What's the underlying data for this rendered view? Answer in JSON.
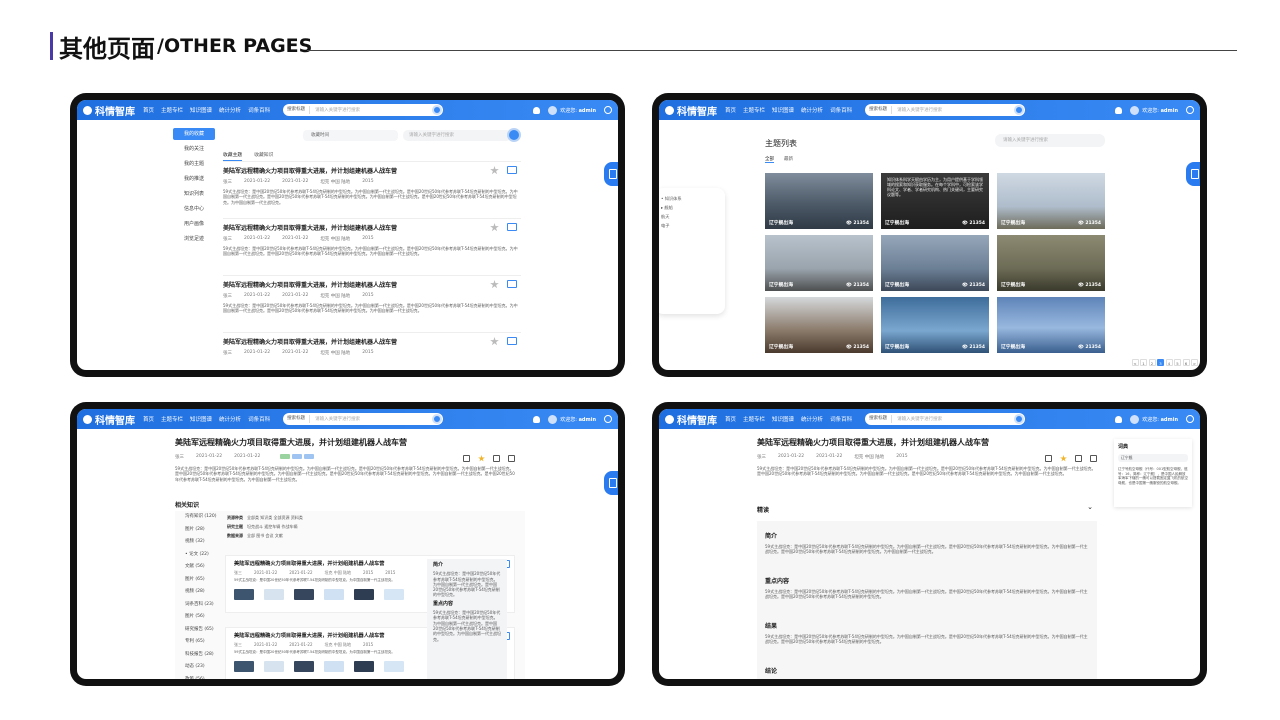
{
  "header": {
    "title_cn": "其他页面",
    "title_en": "/OTHER PAGES"
  },
  "colors": {
    "accent": "#3a8af5",
    "nav_start": "#1f6fe0",
    "nav_end": "#3a8af5",
    "star_active": "#f0b52b",
    "star_inactive": "#bbbbbb",
    "device_frame": "#111111"
  },
  "app": {
    "logo": "科情智库",
    "nav": [
      "首页",
      "主题专栏",
      "知识图谱",
      "统计分析",
      "词条百科"
    ],
    "search_select": "搜索标题",
    "search_placeholder": "请输入关键字进行搜索",
    "welcome": "欢迎您:",
    "user": "admin"
  },
  "screen1": {
    "sidebar": [
      "我的收藏",
      "我的关注",
      "我的主题",
      "我的推送",
      "知识列表",
      "信息中心",
      "用户画像",
      "浏览足迹"
    ],
    "field_label": "收藏时间",
    "search_placeholder": "请输入关键字进行搜索",
    "tabs": [
      "收藏主题",
      "收藏知识"
    ],
    "articles": [
      {
        "title": "美陆军远程精确火力项目取得重大进展，并计划组建机器人战车营",
        "author": "张三",
        "date1": "2021-01-22",
        "date2": "2021-01-22",
        "tags": "坦克   中国   陆地",
        "views": "2015",
        "body": "59式主战坦克：是中国20世纪50年代参考苏联T-54坦克研制的中型坦克。为中国自制第一代主战坦克。是中国20世纪50年代参考苏联T-54坦克研制的中型坦克。为中国自制第一代主战坦克。是中国20世纪50年代参考苏联T-54坦克研制的中型坦克。为中国自制第一代主战坦克。是中国20世纪50年代参考苏联T-54坦克研制的中型坦克。为中国自制第一代主战坦克。"
      },
      {
        "title": "美陆军远程精确火力项目取得重大进展，并计划组建机器人战车营",
        "author": "张三",
        "date1": "2021-01-22",
        "date2": "2021-01-22",
        "tags": "坦克   中国   陆地",
        "views": "2015",
        "body": "59式主战坦克：是中国20世纪50年代参考苏联T-54坦克研制的中型坦克。为中国自制第一代主战坦克。是中国20世纪50年代参考苏联T-54坦克研制的中型坦克。为中国自制第一代主战坦克。是中国20世纪50年代参考苏联T-54坦克研制的中型坦克。为中国自制第一代主战坦克。"
      },
      {
        "title": "美陆军远程精确火力项目取得重大进展，并计划组建机器人战车营",
        "author": "张三",
        "date1": "2021-01-22",
        "date2": "2021-01-22",
        "tags": "坦克   中国   陆地",
        "views": "2015",
        "body": "59式主战坦克：是中国20世纪50年代参考苏联T-54坦克研制的中型坦克。为中国自制第一代主战坦克。是中国20世纪50年代参考苏联T-54坦克研制的中型坦克。为中国自制第一代主战坦克。是中国20世纪50年代参考苏联T-54坦克研制的中型坦克。为中国自制第一代主战坦克。"
      },
      {
        "title": "美陆军远程精确火力项目取得重大进展，并计划组建机器人战车营",
        "author": "张三",
        "date1": "2021-01-22",
        "date2": "2021-01-22",
        "tags": "坦克   中国   陆地",
        "views": "2015",
        "body": ""
      }
    ]
  },
  "screen2": {
    "title": "主题列表",
    "tabs": [
      "全部",
      "最新"
    ],
    "search_placeholder": "请输入关键字进行搜索",
    "tree": [
      "• 知识体系",
      "  ▸ 舰船",
      "    航天",
      "    电子"
    ],
    "tiles": [
      {
        "label": "辽宁舰出海",
        "count": "👁 21354",
        "overlay": ""
      },
      {
        "label": "辽宁舰出海",
        "count": "👁 21354",
        "overlay": "知识体系科学天赋由学历为主，为用户提供基于学科领域的搜索和知识获取服务。在每个学科中，可检索该学科论文、学者、学者研究机构、热门关键词，主要研究议题等。"
      },
      {
        "label": "辽宁舰出海",
        "count": "👁 21354",
        "overlay": ""
      },
      {
        "label": "辽宁舰出海",
        "count": "👁 21354",
        "overlay": ""
      },
      {
        "label": "辽宁舰出海",
        "count": "👁 21354",
        "overlay": ""
      },
      {
        "label": "辽宁舰出海",
        "count": "👁 21354",
        "overlay": ""
      },
      {
        "label": "辽宁舰出海",
        "count": "👁 21354",
        "overlay": ""
      },
      {
        "label": "辽宁舰出海",
        "count": "👁 21354",
        "overlay": ""
      },
      {
        "label": "辽宁舰出海",
        "count": "👁 21354",
        "overlay": ""
      }
    ],
    "pagination": [
      "<",
      "1",
      "2",
      "3",
      "4",
      "5",
      "6",
      ">"
    ]
  },
  "screen3": {
    "title": "美陆军远程精确火力项目取得重大进展，并计划组建机器人战车营",
    "author": "张三",
    "date1": "2021-01-22",
    "date2": "2021-01-22",
    "body": "59式主战坦克：是中国20世纪50年代参考苏联T-54坦克研制的中型坦克。为中国自制第一代主战坦克。是中国20世纪50年代参考苏联T-54坦克研制的中型坦克。为中国自制第一代主战坦克。是中国20世纪50年代参考苏联T-54坦克研制的中型坦克。为中国自制第一代主战坦克。是中国20世纪50年代参考苏联T-54坦克研制的中型坦克。为中国自制第一代主战坦克。是中国20世纪50年代参考苏联T-54坦克研制的中型坦克。为中国自制第一代主战坦克。",
    "related_label": "相关知识",
    "related_side": [
      "沟有知识 (120)",
      "图片 (28)",
      "视频 (32)",
      "• 论文 (22)",
      "文献 (56)",
      "图片 (65)",
      "视频 (28)",
      "词条百科 (23)",
      "图片 (56)",
      "研究报告 (65)",
      "专利 (65)",
      "科技报告 (28)",
      "动态 (23)",
      "政策 (56)"
    ],
    "filter": [
      [
        "资源种类",
        "全部类  知识类  全部资源  资料类"
      ],
      [
        "研究主题",
        "坦克战斗  遥控车辆  作战车辆"
      ],
      [
        "数据来源",
        "全部  图书  会议  文献"
      ]
    ],
    "cards": [
      {
        "title": "美陆军远程精确火力项目取得重大进展，并计划组建机器人战车营",
        "author": "张三",
        "date1": "2021-01-22",
        "date2": "2021-01-22",
        "tags": "坦克  中国  陆地",
        "views": "2015",
        "views2": "2015",
        "body": "59式主战坦克：是中国20世纪50年代参考苏联T-54坦克研制的中型坦克。为中国自制第一代主战坦克。"
      },
      {
        "title": "美陆军远程精确火力项目取得重大进展，并计划组建机器人战车营",
        "author": "张三",
        "date1": "2021-01-22",
        "date2": "2021-01-22",
        "tags": "坦克  中国  陆地",
        "views": "2015",
        "views2": "",
        "body": "59式主战坦克：是中国20世纪50年代参考苏联T-54坦克研制的中型坦克。为中国自制第一代主战坦克。"
      }
    ],
    "intro_label": "简介",
    "intro_body": "59式主战坦克：是中国20世纪50年代参考苏联T-54坦克研制的中型坦克。为中国自制第一代主战坦克。是中国20世纪50年代参考苏联T-54坦克研制的中型坦克。",
    "key_label": "重点内容",
    "key_body": "59式主战坦克：是中国20世纪50年代参考苏联T-54坦克研制的中型坦克。为中国自制第一代主战坦克。是中国20世纪50年代参考苏联T-54坦克研制的中型坦克。为中国自制第一代主战坦克。"
  },
  "screen4": {
    "title": "美陆军远程精确火力项目取得重大进展，并计划组建机器人战车营",
    "author": "张三",
    "date1": "2021-01-22",
    "date2": "2021-01-22",
    "tags": "坦克   中国   陆地",
    "views": "2015",
    "body": "59式主战坦克：是中国20世纪50年代参考苏联T-54坦克研制的中型坦克。为中国自制第一代主战坦克。是中国20世纪50年代参考苏联T-54坦克研制的中型坦克。为中国自制第一代主战坦克。是中国20世纪50年代参考苏联T-54坦克研制的中型坦克。为中国自制第一代主战坦克。是中国20世纪50年代参考苏联T-54坦克研制的中型坦克。为中国自制第一代主战坦克。",
    "read_label": "精读",
    "sections": [
      {
        "h": "简介",
        "body": "59式主战坦克：是中国20世纪50年代参考苏联T-54坦克研制的中型坦克。为中国自制第一代主战坦克。是中国20世纪50年代参考苏联T-54坦克研制的中型坦克。为中国自制第一代主战坦克。是中国20世纪50年代参考苏联T-54坦克研制的中型坦克。为中国自制第一代主战坦克。"
      },
      {
        "h": "重点内容",
        "body": "59式主战坦克：是中国20世纪50年代参考苏联T-54坦克研制的中型坦克。为中国自制第一代主战坦克。是中国20世纪50年代参考苏联T-54坦克研制的中型坦克。为中国自制第一代主战坦克。是中国20世纪50年代参考苏联T-54坦克研制的中型坦克。"
      },
      {
        "h": "结果",
        "body": "59式主战坦克：是中国20世纪50年代参考苏联T-54坦克研制的中型坦克。为中国自制第一代主战坦克。是中国20世纪50年代参考苏联T-54坦克研制的中型坦克。为中国自制第一代主战坦克。是中国20世纪50年代参考苏联T-54坦克研制的中型坦克。"
      },
      {
        "h": "结论",
        "body": "59式主战坦克：是中国20世纪50年代参考苏联T-54坦克研制的中型坦克。为中国自制第一代主战坦克。是中国20世纪50年代参考苏联T-54坦克研制的中型坦克。为中国自制第一代主战坦克。"
      }
    ],
    "dict_label": "词典",
    "dict_search": "辽宁舰",
    "dict_text": "辽宁号航空母舰（代号：001型航空母舰，舷号：16，简称：辽宁舰），是中国人民解放军海军下辖的一艘可以搭载固定翼飞机的航空母舰，也是中国第一艘服役的航空母舰。"
  }
}
